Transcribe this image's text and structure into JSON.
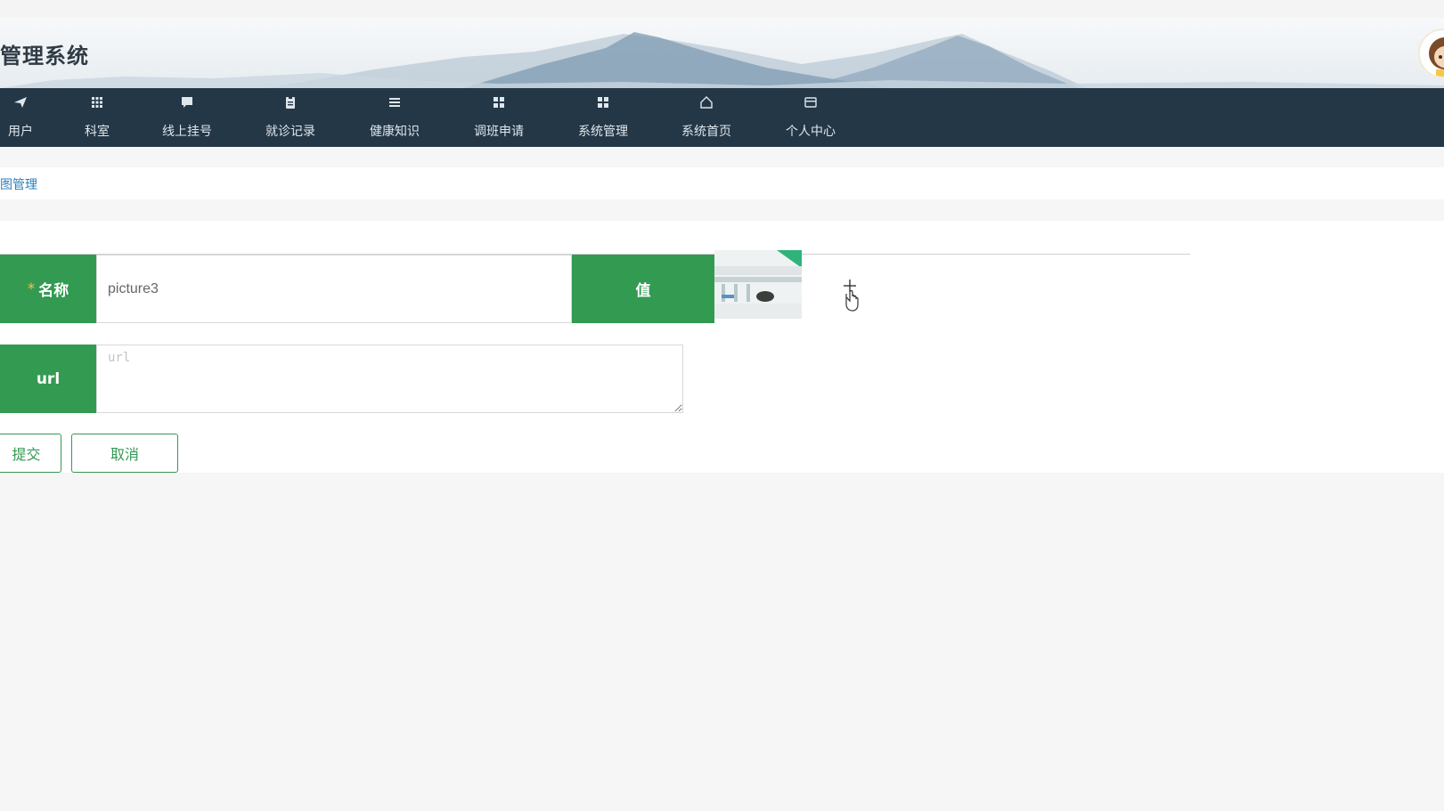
{
  "header": {
    "title": "管理系统",
    "avatar_icon": "user-avatar-icon"
  },
  "nav": {
    "items": [
      {
        "label": "用户",
        "icon": "send-icon"
      },
      {
        "label": "科室",
        "icon": "grid-icon"
      },
      {
        "label": "线上挂号",
        "icon": "message-icon"
      },
      {
        "label": "就诊记录",
        "icon": "clipboard-icon"
      },
      {
        "label": "健康知识",
        "icon": "list-icon"
      },
      {
        "label": "调班申请",
        "icon": "apps-icon"
      },
      {
        "label": "系统管理",
        "icon": "apps-icon"
      },
      {
        "label": "系统首页",
        "icon": "home-icon"
      },
      {
        "label": "个人中心",
        "icon": "card-icon"
      }
    ]
  },
  "breadcrumb": {
    "text": "图管理"
  },
  "form": {
    "name_label": "名称",
    "name_required_mark": "*",
    "name_value": "picture3",
    "value_label": "值",
    "url_label": "url",
    "url_placeholder": "url",
    "submit_label": "提交",
    "cancel_label": "取消"
  },
  "colors": {
    "nav_bg": "#243746",
    "accent_green": "#339a52",
    "breadcrumb_link": "#2d7fb8"
  }
}
